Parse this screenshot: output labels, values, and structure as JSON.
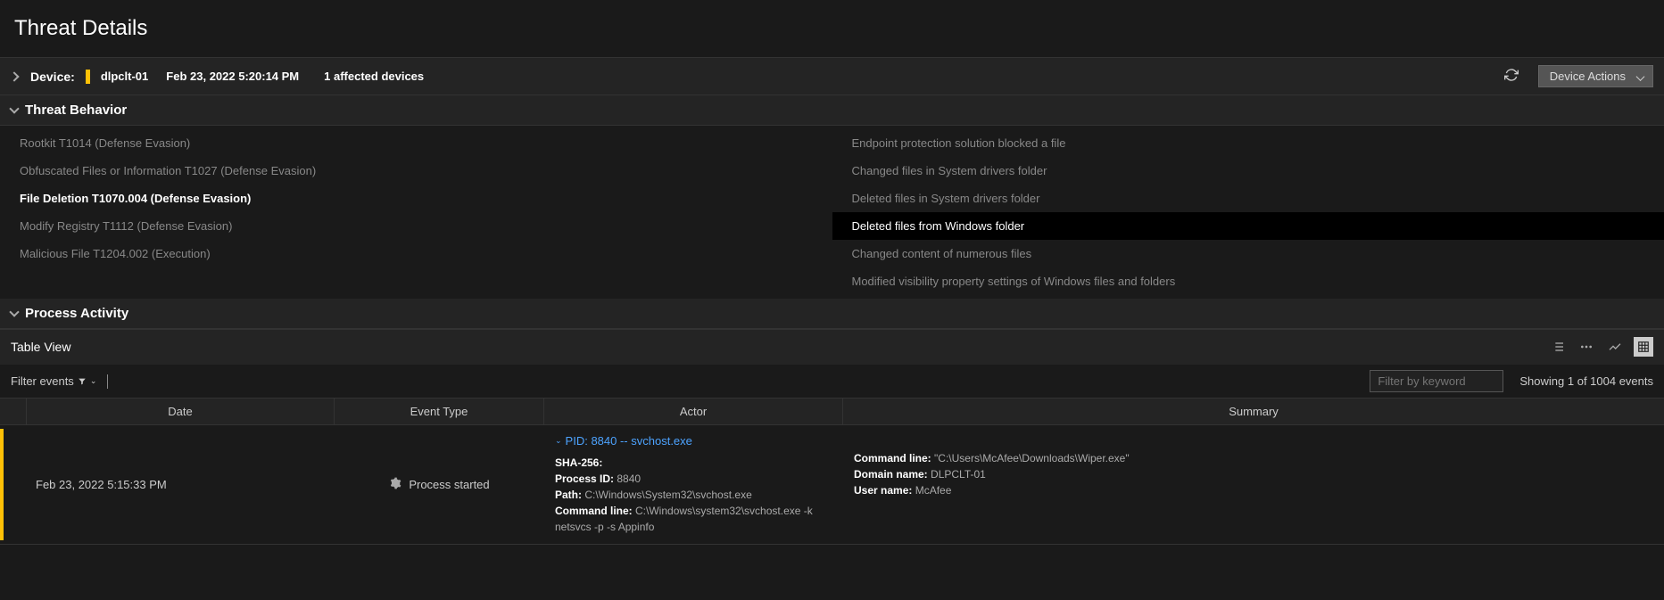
{
  "page_title": "Threat Details",
  "device_bar": {
    "label": "Device:",
    "device_name": "dlpclt-01",
    "timestamp": "Feb 23, 2022 5:20:14 PM",
    "affected": "1 affected devices",
    "device_actions_label": "Device Actions"
  },
  "threat_behavior": {
    "header": "Threat Behavior",
    "left_items": [
      {
        "label": "Rootkit T1014 (Defense Evasion)",
        "style": ""
      },
      {
        "label": "Obfuscated Files or Information T1027 (Defense Evasion)",
        "style": ""
      },
      {
        "label": "File Deletion T1070.004 (Defense Evasion)",
        "style": "bold-white"
      },
      {
        "label": "Modify Registry T1112 (Defense Evasion)",
        "style": ""
      },
      {
        "label": "Malicious File T1204.002 (Execution)",
        "style": ""
      }
    ],
    "right_items": [
      {
        "label": "Endpoint protection solution blocked a file",
        "style": ""
      },
      {
        "label": "Changed files in System drivers folder",
        "style": ""
      },
      {
        "label": "Deleted files in System drivers folder",
        "style": ""
      },
      {
        "label": "Deleted files from Windows folder",
        "style": "selected"
      },
      {
        "label": "Changed content of numerous files",
        "style": ""
      },
      {
        "label": "Modified visibility property settings of Windows files and folders",
        "style": ""
      }
    ]
  },
  "process_activity": {
    "header": "Process Activity",
    "table_view_label": "Table View",
    "filter_events_label": "Filter events",
    "filter_kw_placeholder": "Filter by keyword",
    "showing_text": "Showing 1 of 1004 events",
    "columns": {
      "date": "Date",
      "event_type": "Event Type",
      "actor": "Actor",
      "summary": "Summary"
    },
    "row": {
      "date": "Feb 23, 2022 5:15:33 PM",
      "event_type": "Process started",
      "pid_link": "PID: 8840 -- svchost.exe",
      "actor_details": {
        "sha_label": "SHA-256:",
        "sha_value": "",
        "pid_label": "Process ID:",
        "pid_value": "8840",
        "path_label": "Path:",
        "path_value": "C:\\Windows\\System32\\svchost.exe",
        "cmd_label": "Command line:",
        "cmd_value": "C:\\Windows\\system32\\svchost.exe -k netsvcs -p -s Appinfo"
      },
      "summary_details": {
        "cmd_label": "Command line:",
        "cmd_value": "\"C:\\Users\\McAfee\\Downloads\\Wiper.exe\"",
        "domain_label": "Domain name:",
        "domain_value": "DLPCLT-01",
        "user_label": "User name:",
        "user_value": "McAfee"
      }
    }
  }
}
